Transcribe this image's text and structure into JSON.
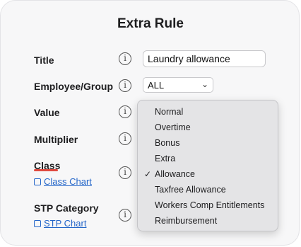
{
  "dialog": {
    "title": "Extra Rule"
  },
  "fields": {
    "title_label": "Title",
    "title_value": "Laundry allowance",
    "employee_label": "Employee/Group",
    "employee_value": "ALL",
    "value_label": "Value",
    "multiplier_label": "Multiplier",
    "class_label": "Class",
    "class_link": "Class Chart",
    "stp_label": "STP Category",
    "stp_link": "STP Chart"
  },
  "info_icon": "i",
  "class_dropdown": {
    "options": [
      "Normal",
      "Overtime",
      "Bonus",
      "Extra",
      "Allowance",
      "Taxfree Allowance",
      "Workers Comp Entitlements",
      "Reimbursement"
    ],
    "selected": "Allowance",
    "check_glyph": "✓"
  },
  "colors": {
    "accent_underline": "#e04a3f",
    "link": "#2466c9"
  }
}
